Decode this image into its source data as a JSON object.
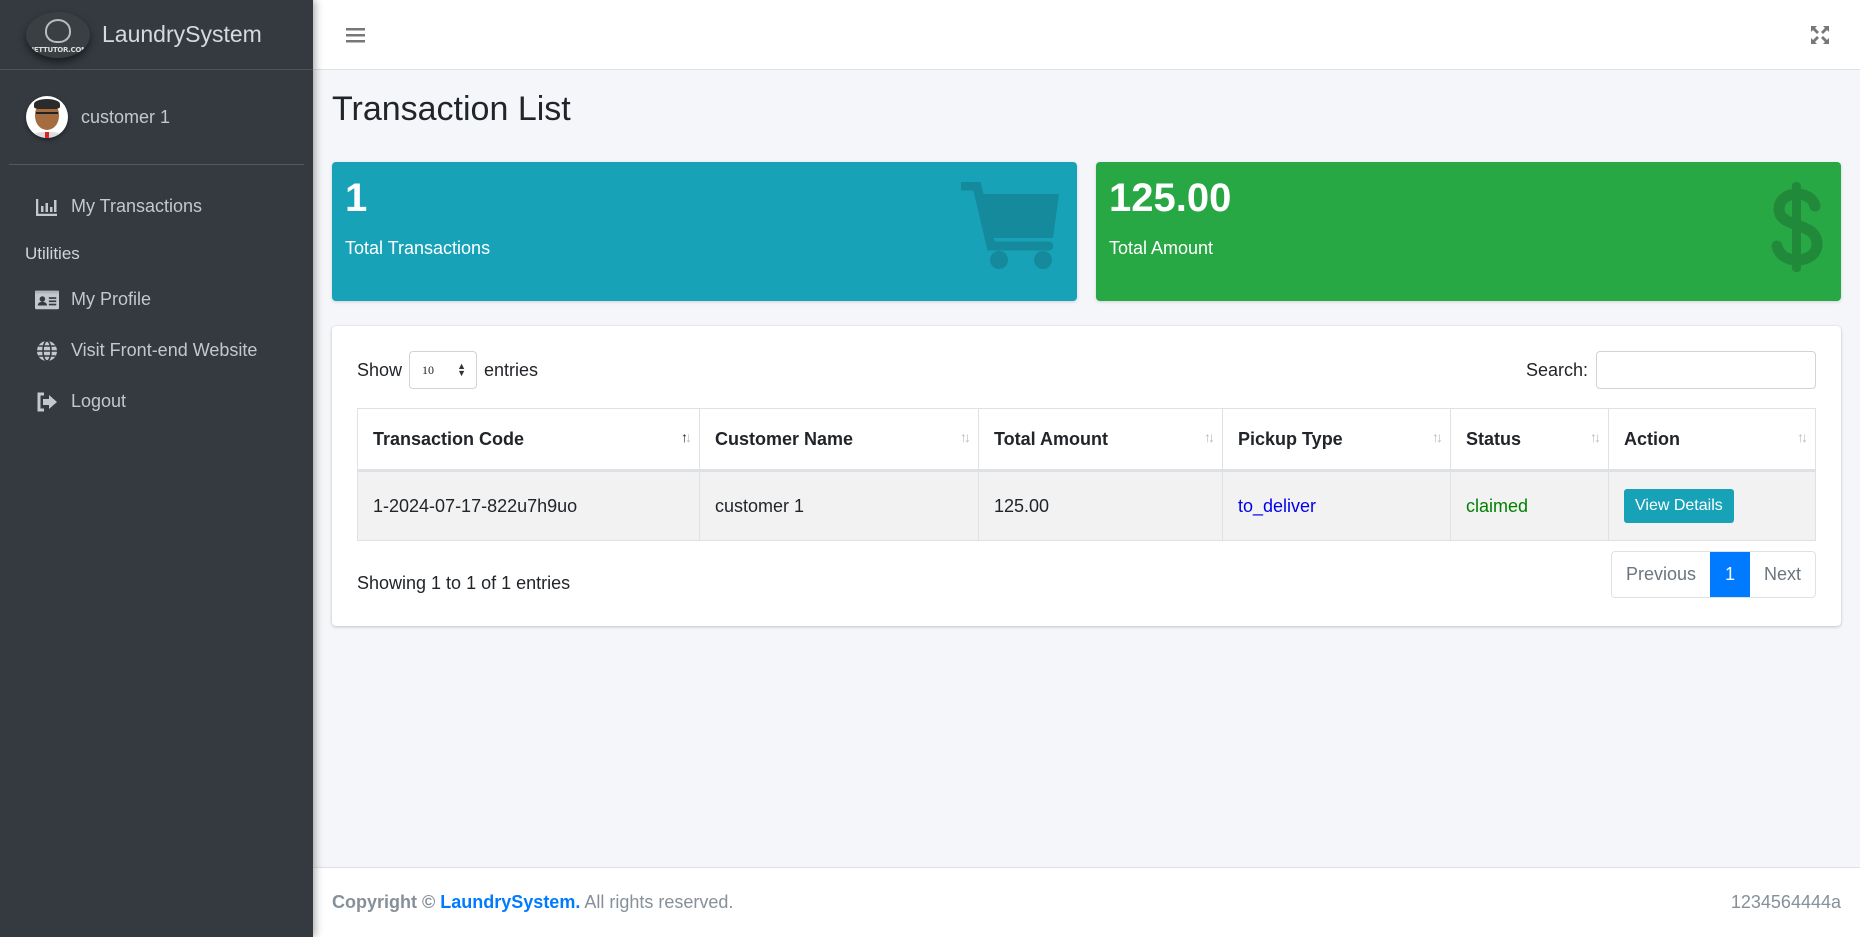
{
  "brand": {
    "name": "LaundrySystem",
    "logo_text": "NETTUTOR.COM"
  },
  "user": {
    "name": "customer 1"
  },
  "sidebar": {
    "items": [
      {
        "label": "My Transactions",
        "icon": "chart-bar-icon"
      }
    ],
    "header": "Utilities",
    "utilities": [
      {
        "label": "My Profile",
        "icon": "id-card-icon"
      },
      {
        "label": "Visit Front-end Website",
        "icon": "globe-icon"
      },
      {
        "label": "Logout",
        "icon": "sign-out-icon"
      }
    ]
  },
  "topbar": {
    "menu_icon": "hamburger-icon",
    "fullscreen_icon": "expand-icon"
  },
  "page": {
    "title": "Transaction List"
  },
  "stats": [
    {
      "value": "1",
      "label": "Total Transactions",
      "icon": "shopping-cart-icon",
      "color": "#17a2b8"
    },
    {
      "value": "125.00",
      "label": "Total Amount",
      "icon": "dollar-sign-icon",
      "color": "#28a745"
    }
  ],
  "datatable": {
    "show_label": "Show",
    "entries_label": "entries",
    "page_length": "10",
    "search_label": "Search:",
    "search_value": "",
    "columns": [
      "Transaction Code",
      "Customer Name",
      "Total Amount",
      "Pickup Type",
      "Status",
      "Action"
    ],
    "rows": [
      {
        "code": "1-2024-07-17-822u7h9uo",
        "customer": "customer 1",
        "amount": "125.00",
        "pickup_type": "to_deliver",
        "status": "claimed",
        "action": "View Details"
      }
    ],
    "info": "Showing 1 to 1 of 1 entries",
    "pagination": {
      "previous": "Previous",
      "current": "1",
      "next": "Next"
    }
  },
  "footer": {
    "copyright": "Copyright ©",
    "brand_link": "LaundrySystem.",
    "rights": "All rights reserved.",
    "right_text": "1234564444a"
  }
}
